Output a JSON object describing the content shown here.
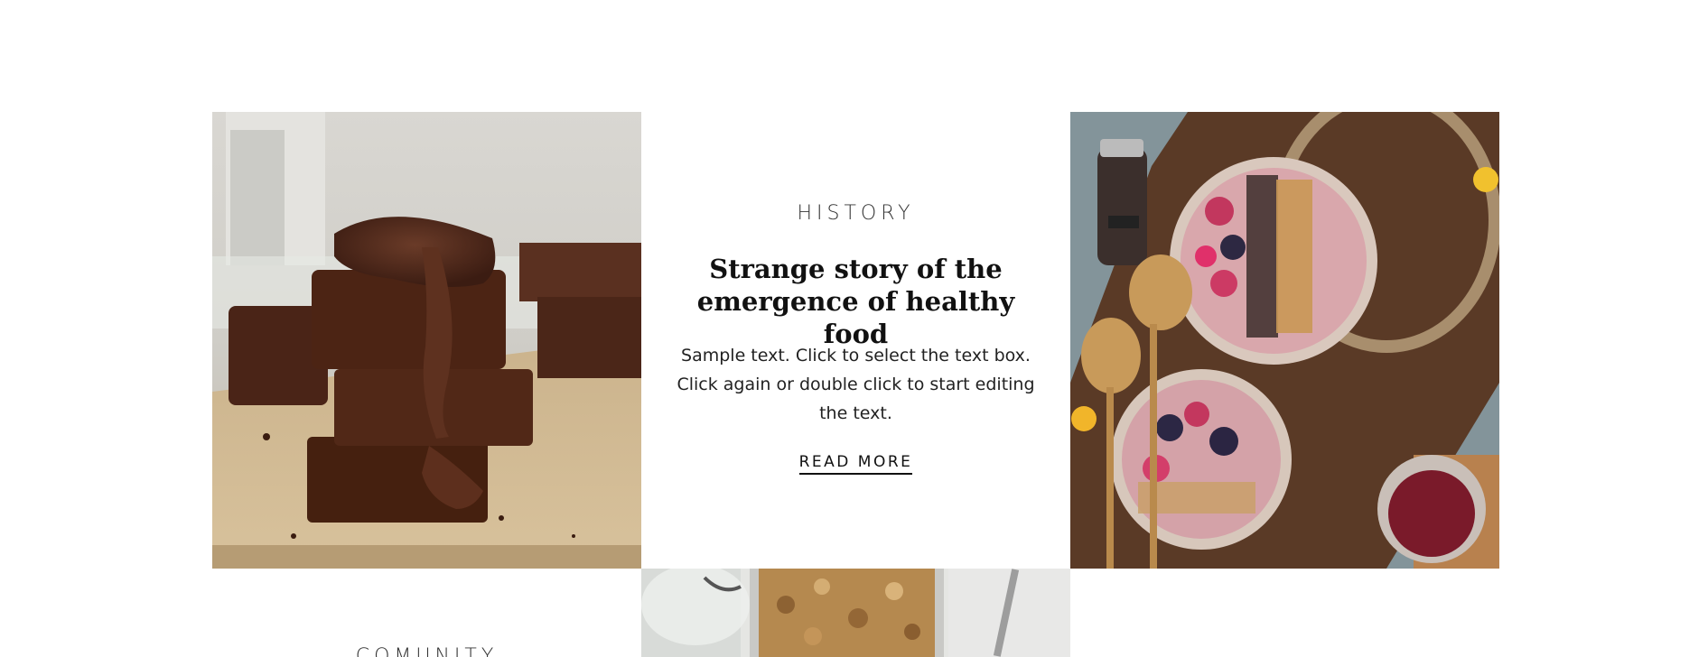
{
  "card_history": {
    "eyebrow": "HISTORY",
    "headline": "Strange story of the emergence of healthy food",
    "body": "Sample text. Click to select the text box. Click again or double click to start editing the text.",
    "cta_label": "READ MORE"
  },
  "card_comunity": {
    "eyebrow": "COMUNITY"
  },
  "images": {
    "left": "chocolate-brownies-photo",
    "right": "smoothie-bowls-photo",
    "bottom_center": "granola-jar-photo"
  },
  "colors": {
    "text": "#111111",
    "background": "#ffffff"
  }
}
